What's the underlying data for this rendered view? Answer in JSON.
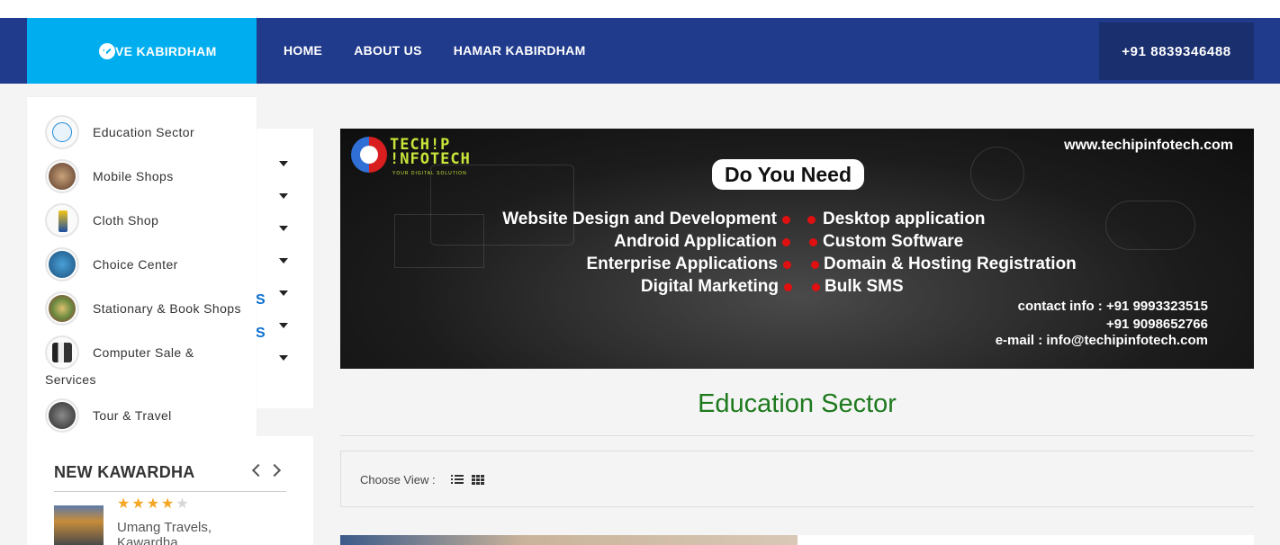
{
  "nav": {
    "live_label": "LIVE KABIRDHAM",
    "items": [
      "HOME",
      "ABOUT US",
      "HAMAR KABIRDHAM"
    ],
    "phone": "+91 8839346488"
  },
  "categories": [
    {
      "label": "Education Sector",
      "icon": "education-icon"
    },
    {
      "label": "Mobile Shops",
      "icon": "mobile-shop-icon"
    },
    {
      "label": "Cloth Shop",
      "icon": "cloth-shop-icon"
    },
    {
      "label": "Choice Center",
      "icon": "choice-center-icon"
    },
    {
      "label": "Stationary & Book Shops",
      "icon": "stationary-icon"
    },
    {
      "label": "Computer Sale &",
      "label_cont": "Services",
      "icon": "computer-icon"
    },
    {
      "label": "Tour & Travel",
      "icon": "tour-travel-icon"
    }
  ],
  "sidebar_partial_text": [
    "S",
    "S"
  ],
  "kawardha": {
    "title": "NEW KAWARDHA",
    "listing": {
      "name_line1": "Umang Travels,",
      "name_line2": "Kawardha",
      "rating": 4,
      "max_rating": 5
    }
  },
  "banner": {
    "logo_line1": "TECH!P",
    "logo_line2": "!NFOTECH",
    "logo_tagline": "YOUR DIGITAL SOLUTION",
    "url": "www.techipinfotech.com",
    "headline": "Do You Need",
    "services_left": [
      "Website Design and Development",
      "Android Application",
      "Enterprise Applications",
      "Digital Marketing"
    ],
    "services_right": [
      "Desktop application",
      "Custom Software",
      "Domain & Hosting Registration",
      "Bulk SMS"
    ],
    "contact_line1": "contact info : +91 9993323515",
    "contact_line2": "+91 9098652766",
    "contact_line3": "e-mail : info@techipinfotech.com"
  },
  "main": {
    "sector_title": "Education Sector",
    "choose_view_label": "Choose View :"
  },
  "colors": {
    "nav_bg": "#213b8c",
    "live_bg": "#00aeef",
    "phone_bg": "#1a2f6e",
    "sector_title": "#1e7a1e",
    "star": "#f5a623"
  }
}
